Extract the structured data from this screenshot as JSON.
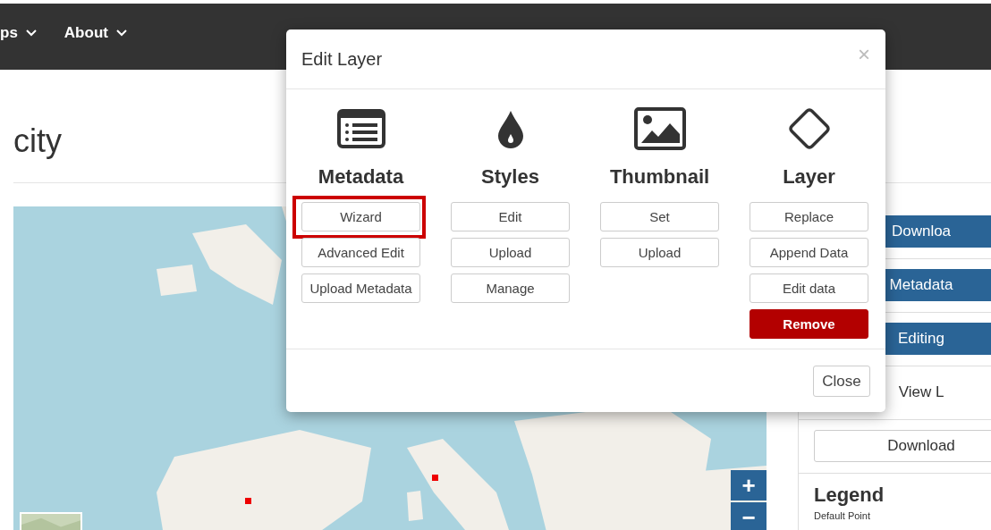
{
  "nav": {
    "items": [
      {
        "label": "ps"
      },
      {
        "label": "About"
      }
    ]
  },
  "page": {
    "title": "city"
  },
  "map": {
    "kind": "picture",
    "zoom_in": "+",
    "zoom_out": "−"
  },
  "sidebar": {
    "buttons": [
      {
        "label": "Downloa",
        "kind": "primary"
      },
      {
        "label": "Metadata",
        "kind": "primary"
      },
      {
        "label": "Editing",
        "kind": "primary"
      },
      {
        "label": "View L",
        "kind": "plain"
      },
      {
        "label": "Download",
        "kind": "outline"
      }
    ],
    "legend": {
      "title": "Legend",
      "item": "Default Point"
    }
  },
  "dialog": {
    "title": "Edit Layer",
    "close": "×",
    "sections": [
      {
        "heading": "Metadata",
        "buttons": [
          {
            "label": "Wizard",
            "kind": "default",
            "highlighted": true
          },
          {
            "label": "Advanced Edit",
            "kind": "default",
            "highlighted": false
          },
          {
            "label": "Upload Metadata",
            "kind": "default",
            "highlighted": false
          }
        ]
      },
      {
        "heading": "Styles",
        "buttons": [
          {
            "label": "Edit",
            "kind": "default",
            "highlighted": false
          },
          {
            "label": "Upload",
            "kind": "default",
            "highlighted": false
          },
          {
            "label": "Manage",
            "kind": "default",
            "highlighted": false
          }
        ]
      },
      {
        "heading": "Thumbnail",
        "buttons": [
          {
            "label": "Set",
            "kind": "default",
            "highlighted": false
          },
          {
            "label": "Upload",
            "kind": "default",
            "highlighted": false
          }
        ]
      },
      {
        "heading": "Layer",
        "buttons": [
          {
            "label": "Replace",
            "kind": "default",
            "highlighted": false
          },
          {
            "label": "Append Data",
            "kind": "default",
            "highlighted": false
          },
          {
            "label": "Edit data",
            "kind": "default",
            "highlighted": false
          },
          {
            "label": "Remove",
            "kind": "danger",
            "highlighted": false
          }
        ]
      }
    ],
    "footer_button": "Close"
  }
}
